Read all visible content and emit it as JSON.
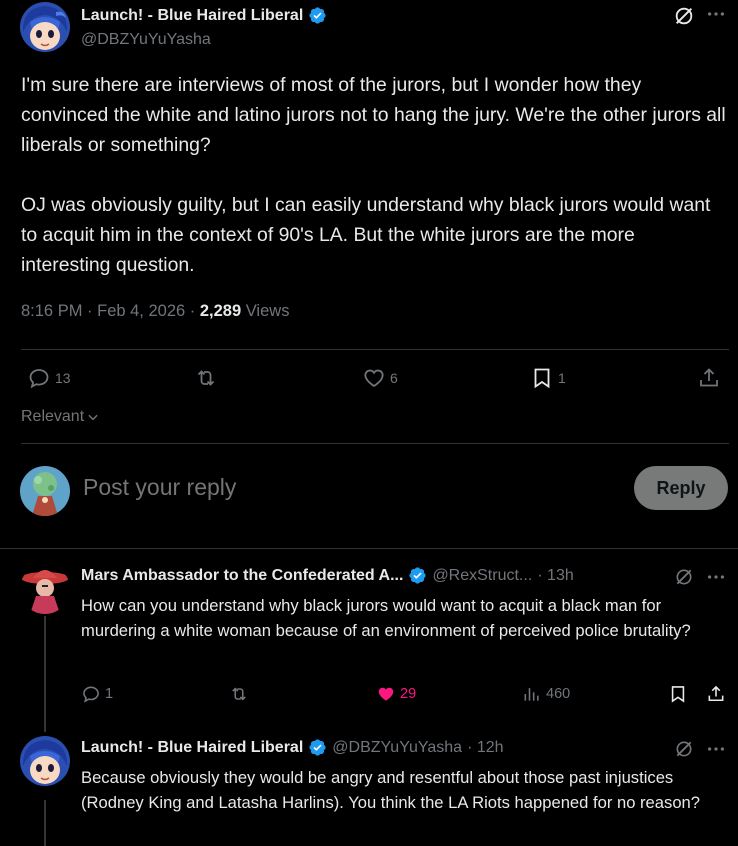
{
  "main_tweet": {
    "author_name": "Launch! - Blue Haired Liberal",
    "author_handle": "@DBZYuYuYasha",
    "body_p1": "I'm sure there are interviews of most of the jurors, but I wonder how they convinced the white and latino jurors not to hang the jury. We're the other jurors all liberals or something?",
    "body_p2": "OJ was obviously guilty, but I can easily understand why black jurors would want to acquit him in the context of 90's LA. But the white jurors are the more interesting question.",
    "timestamp": "8:16 PM · Feb 4, 2026 · ",
    "views_count": "2,289",
    "views_label": " Views",
    "replies": "13",
    "reposts": "",
    "likes": "6",
    "bookmarks": "1"
  },
  "sort": {
    "label": "Relevant"
  },
  "compose": {
    "placeholder": "Post your reply",
    "button": "Reply"
  },
  "replies": [
    {
      "name": "Mars Ambassador to the Confederated A...",
      "handle": "@RexStruct...",
      "time": " · 13h",
      "text": "How can you understand why black jurors would want to acquit a black man for murdering a white woman because of an environment of perceived police brutality?",
      "reply_count": "1",
      "likes": "29",
      "views": "460"
    },
    {
      "name": "Launch! - Blue Haired Liberal",
      "handle": "@DBZYuYuYasha",
      "time": " · 12h",
      "text": "Because obviously they would be angry and resentful about those past injustices (Rodney King and Latasha Harlins). You think the LA Riots happened for no reason?"
    }
  ],
  "colors": {
    "accent": "#1d9bf0",
    "like": "#f91880",
    "muted": "#71767b",
    "border": "#2f3336"
  }
}
